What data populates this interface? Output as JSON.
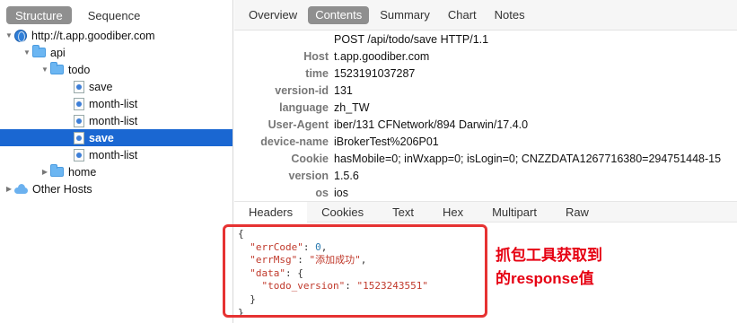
{
  "left_panel": {
    "view_tabs": [
      "Structure",
      "Sequence"
    ],
    "active_view": "Structure",
    "tree": [
      {
        "label": "http://t.app.goodiber.com",
        "type": "host",
        "indent": 0,
        "expanded": true
      },
      {
        "label": "api",
        "type": "folder",
        "indent": 1,
        "expanded": true
      },
      {
        "label": "todo",
        "type": "folder",
        "indent": 2,
        "expanded": true
      },
      {
        "label": "save",
        "type": "file",
        "indent": 3
      },
      {
        "label": "month-list",
        "type": "file",
        "indent": 3
      },
      {
        "label": "month-list",
        "type": "file",
        "indent": 3
      },
      {
        "label": "save",
        "type": "file",
        "indent": 3,
        "selected": true
      },
      {
        "label": "month-list",
        "type": "file",
        "indent": 3
      },
      {
        "label": "home",
        "type": "folder",
        "indent": 2,
        "expanded": false
      },
      {
        "label": "Other Hosts",
        "type": "hosts",
        "indent": 0,
        "expanded": false
      }
    ]
  },
  "right_panel": {
    "tabs": [
      "Overview",
      "Contents",
      "Summary",
      "Chart",
      "Notes"
    ],
    "active_tab": "Contents",
    "request_line": "POST /api/todo/save HTTP/1.1",
    "headers": [
      {
        "key": "Host",
        "value": "t.app.goodiber.com"
      },
      {
        "key": "time",
        "value": "1523191037287"
      },
      {
        "key": "version-id",
        "value": "131"
      },
      {
        "key": "language",
        "value": "zh_TW"
      },
      {
        "key": "User-Agent",
        "value": "iber/131 CFNetwork/894 Darwin/17.4.0"
      },
      {
        "key": "device-name",
        "value": "iBrokerTest%206P01"
      },
      {
        "key": "Cookie",
        "value": "hasMobile=0; inWxapp=0; isLogin=0; CNZZDATA1267716380=294751448-15"
      },
      {
        "key": "version",
        "value": "1.5.6"
      },
      {
        "key": "os",
        "value": "ios"
      }
    ],
    "response_tabs": [
      "Headers",
      "Cookies",
      "Text",
      "Hex",
      "Multipart",
      "Raw"
    ],
    "active_response_tab": "Headers",
    "response_json": {
      "open": "{",
      "errCode_key": "\"errCode\"",
      "errCode_val": "0",
      "errMsg_key": "\"errMsg\"",
      "errMsg_val": "\"添加成功\"",
      "data_key": "\"data\"",
      "todo_version_key": "\"todo_version\"",
      "todo_version_val": "\"1523243551\"",
      "close_inner": "}",
      "close": "}"
    }
  },
  "annotation": {
    "line1": "抓包工具获取到",
    "line2": "的response值",
    "color": "#e60012"
  },
  "colors": {
    "selection": "#1a67d2",
    "active_tab": "#8f8f8f",
    "folder": "#6cb6f2",
    "highlight_box": "#e63232"
  }
}
